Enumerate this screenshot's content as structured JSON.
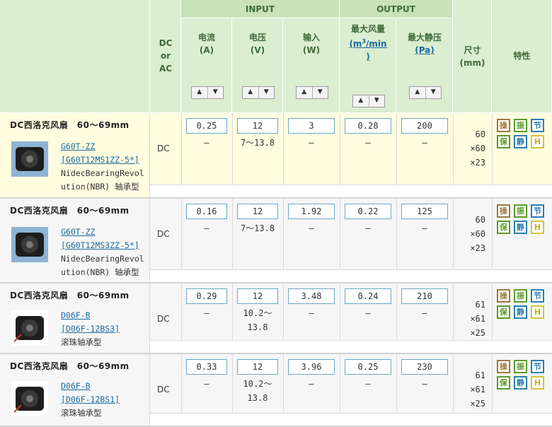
{
  "header": {
    "groups": {
      "input": "INPUT",
      "output": "OUTPUT"
    },
    "dc_ac": [
      "DC",
      "or",
      "AC"
    ],
    "current": {
      "name": "电流",
      "unit": "(A)"
    },
    "voltage": {
      "name": "电压",
      "unit": "(V)"
    },
    "power": {
      "name": "输入",
      "unit": "(W)"
    },
    "airflow": {
      "name": "最大风量",
      "unit_pre": "(m",
      "unit_sup": "3",
      "unit_post": "/min",
      "unit_close": ")"
    },
    "pressure": {
      "name": "最大静压",
      "unit": "(Pa)"
    },
    "size": {
      "name": "尺寸",
      "unit": "(mm)"
    },
    "features": "特性",
    "sort_up": "▲",
    "sort_down": "▼"
  },
  "products": [
    {
      "title": "DC西洛克风扇　60～69mm",
      "model": "G60T-ZZ",
      "part": "[G60T12MS1ZZ-5*]",
      "bearing_1": "NidecBearingRevol",
      "bearing_2": "ution(NBR) 轴承型",
      "type": "DC",
      "current": "0.25",
      "current_range": "–",
      "voltage": "12",
      "voltage_range_1": "7～13.8",
      "voltage_range_2": "",
      "power": "3",
      "power_range": "–",
      "airflow": "0.28",
      "airflow_range": "–",
      "pressure": "200",
      "pressure_range": "–",
      "size_1": "60",
      "size_2": "×60",
      "size_3": "×23",
      "features": [
        "操",
        "振",
        "节",
        "保",
        "静",
        "H"
      ]
    },
    {
      "title": "DC西洛克风扇　60～69mm",
      "model": "G60T-ZZ",
      "part": "[G60T12MS3ZZ-5*]",
      "bearing_1": "NidecBearingRevol",
      "bearing_2": "ution(NBR) 轴承型",
      "type": "DC",
      "current": "0.16",
      "current_range": "–",
      "voltage": "12",
      "voltage_range_1": "7～13.8",
      "voltage_range_2": "",
      "power": "1.92",
      "power_range": "–",
      "airflow": "0.22",
      "airflow_range": "–",
      "pressure": "125",
      "pressure_range": "–",
      "size_1": "60",
      "size_2": "×60",
      "size_3": "×23",
      "features": [
        "操",
        "振",
        "节",
        "保",
        "静",
        "H"
      ]
    },
    {
      "title": "DC西洛克风扇　60～69mm",
      "model": "D06F-B",
      "part": "[D06F-12BS3]",
      "bearing_1": "滚珠轴承型",
      "bearing_2": "",
      "type": "DC",
      "current": "0.29",
      "current_range": "–",
      "voltage": "12",
      "voltage_range_1": "10.2～",
      "voltage_range_2": "13.8",
      "power": "3.48",
      "power_range": "–",
      "airflow": "0.24",
      "airflow_range": "–",
      "pressure": "210",
      "pressure_range": "–",
      "size_1": "61",
      "size_2": "×61",
      "size_3": "×25",
      "features": [
        "操",
        "振",
        "节",
        "保",
        "静",
        "H"
      ]
    },
    {
      "title": "DC西洛克风扇　60～69mm",
      "model": "D06F-B",
      "part": "[D06F-12BS1]",
      "bearing_1": "滚珠轴承型",
      "bearing_2": "",
      "type": "DC",
      "current": "0.33",
      "current_range": "–",
      "voltage": "12",
      "voltage_range_1": "10.2～",
      "voltage_range_2": "13.8",
      "power": "3.96",
      "power_range": "–",
      "airflow": "0.25",
      "airflow_range": "–",
      "pressure": "230",
      "pressure_range": "–",
      "size_1": "61",
      "size_2": "×61",
      "size_3": "×25",
      "features": [
        "操",
        "振",
        "节",
        "保",
        "静",
        "H"
      ]
    }
  ],
  "colors": {
    "header_bg": "#dbeed0",
    "group_bg": "#c8e3b8",
    "row_highlight": "#fffce0",
    "link": "#1a6aa0",
    "input_border": "#6aa7c7"
  }
}
